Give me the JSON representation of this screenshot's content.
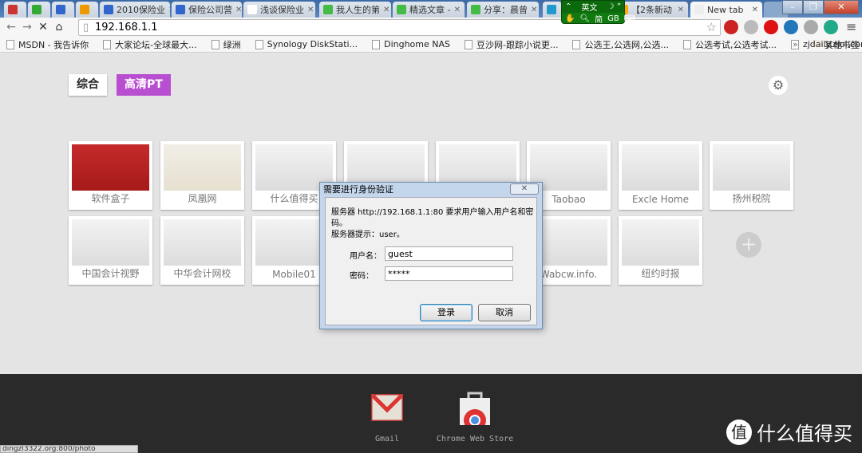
{
  "tabs": [
    {
      "label": "",
      "icon": "tax-icon",
      "color": "#c33"
    },
    {
      "label": "",
      "icon": "green-square-icon",
      "color": "#3a3"
    },
    {
      "label": "",
      "icon": "blue-circle-icon",
      "color": "#36c"
    },
    {
      "label": "",
      "icon": "orange-square-icon",
      "color": "#e90"
    },
    {
      "label": "2010保险业",
      "icon": "baidu-icon",
      "color": "#36c"
    },
    {
      "label": "保险公司营",
      "icon": "baidu-icon",
      "color": "#36c"
    },
    {
      "label": "浅谈保险业",
      "icon": "page-icon",
      "color": "#fff"
    },
    {
      "label": "我人生的第",
      "icon": "green-icon",
      "color": "#4b4"
    },
    {
      "label": "精选文章 -",
      "icon": "green-icon",
      "color": "#4b4"
    },
    {
      "label": "分享：晨曾",
      "icon": "green-icon",
      "color": "#4b4"
    },
    {
      "label": "",
      "icon": "p-icon",
      "color": "#29c"
    },
    {
      "label": "【2条新动",
      "icon": "star-icon",
      "color": "#fa0"
    },
    {
      "label": "New tab",
      "icon": "loading-icon",
      "color": "#eee",
      "active": true
    }
  ],
  "ime": {
    "lang": "英文",
    "mode": "简",
    "width": "GB"
  },
  "url": "192.168.1.1",
  "extensions": [
    {
      "name": "1501-icon",
      "color": "#c22"
    },
    {
      "name": "sync-icon",
      "color": "#bbb"
    },
    {
      "name": "alert-icon",
      "color": "#d11"
    },
    {
      "name": "ipa-icon",
      "color": "#27b"
    },
    {
      "name": "gray-icon",
      "color": "#aaa"
    },
    {
      "name": "edge-icon",
      "color": "#2a8"
    }
  ],
  "bookmarks": [
    "MSDN - 我告诉你",
    "大家论坛-全球最大...",
    "绿洲",
    "Synology DiskStati...",
    "Dinghome NAS",
    "豆沙网-跟踪小说更...",
    "公选王,公选网,公选...",
    "公选考试,公选考试...",
    "zjdaily.zjol.com.cn"
  ],
  "bookmarks_more": "»",
  "other_bookmarks": "其他书签",
  "newtab": {
    "segments": [
      {
        "label": "综合",
        "active": true
      },
      {
        "label": "高清PT",
        "color": "#b84fd0"
      }
    ],
    "tiles_row1": [
      "软件盒子",
      "凤凰网",
      "什么值得买",
      "",
      "",
      "Taobao",
      "Excle Home",
      "扬州税院"
    ],
    "tiles_row2": [
      "中国会计视野",
      "中华会计网校",
      "Mobile01",
      "",
      "Wabcw.info.",
      "纽约时报"
    ],
    "add": "+"
  },
  "apps": [
    {
      "label": "Gmail"
    },
    {
      "label": "Chrome Web Store"
    }
  ],
  "status_url": "dingzl3322.org:800/photo",
  "watermark": "什么值得买",
  "dialog": {
    "title": "需要进行身份验证",
    "message": "服务器 http://192.168.1.1:80 要求用户输入用户名和密码。",
    "hint": "服务器提示：user。",
    "username_label": "用户名：",
    "username": "guest",
    "password_label": "密码：",
    "password": "*****",
    "login": "登录",
    "cancel": "取消"
  }
}
